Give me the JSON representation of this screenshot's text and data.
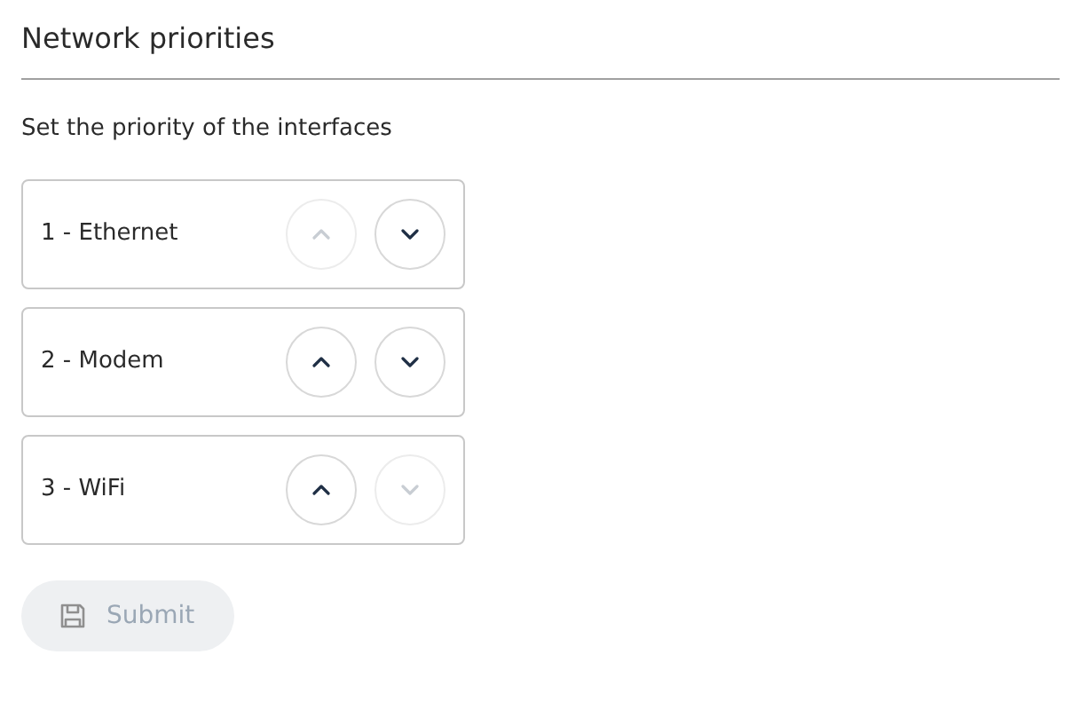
{
  "title": "Network priorities",
  "subtitle": "Set the priority of the interfaces",
  "interfaces": [
    {
      "label": "1 - Ethernet",
      "up_disabled": true,
      "down_disabled": false
    },
    {
      "label": "2 - Modem",
      "up_disabled": false,
      "down_disabled": false
    },
    {
      "label": "3 - WiFi",
      "up_disabled": false,
      "down_disabled": true
    }
  ],
  "submit": {
    "label": "Submit",
    "disabled": true
  }
}
